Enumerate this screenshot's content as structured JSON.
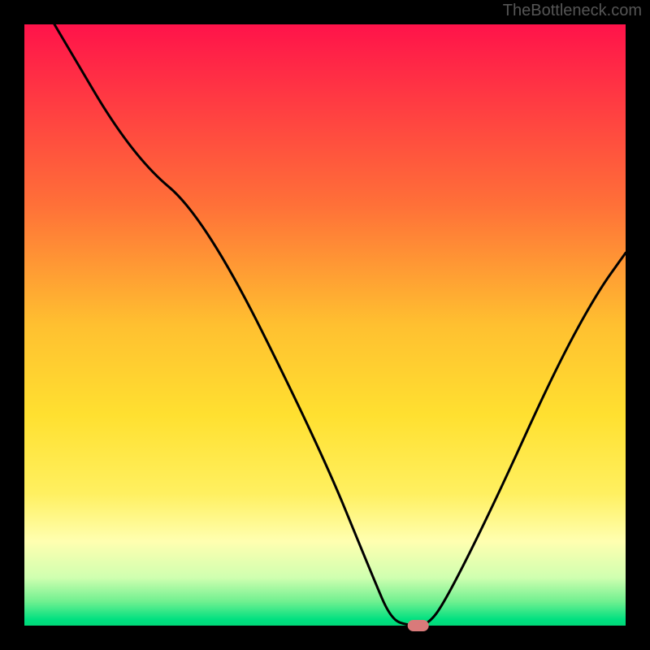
{
  "attribution": "TheBottleneck.com",
  "chart_data": {
    "type": "line",
    "title": "",
    "xlabel": "",
    "ylabel": "",
    "ylim": [
      0,
      100
    ],
    "xlim": [
      0,
      100
    ],
    "background": {
      "type": "vertical_gradient",
      "stops": [
        {
          "offset": 0,
          "color": "#ff134a"
        },
        {
          "offset": 30,
          "color": "#ff7038"
        },
        {
          "offset": 50,
          "color": "#ffc030"
        },
        {
          "offset": 65,
          "color": "#ffe030"
        },
        {
          "offset": 78,
          "color": "#fff060"
        },
        {
          "offset": 86,
          "color": "#ffffb0"
        },
        {
          "offset": 92,
          "color": "#d0ffb0"
        },
        {
          "offset": 96,
          "color": "#70f090"
        },
        {
          "offset": 99,
          "color": "#00e080"
        },
        {
          "offset": 100,
          "color": "#00d878"
        }
      ]
    },
    "series": [
      {
        "name": "bottleneck-curve",
        "color": "#000000",
        "points": [
          {
            "x": 5,
            "y": 100
          },
          {
            "x": 18,
            "y": 78
          },
          {
            "x": 30,
            "y": 68
          },
          {
            "x": 49,
            "y": 30
          },
          {
            "x": 58,
            "y": 8
          },
          {
            "x": 61,
            "y": 1
          },
          {
            "x": 64,
            "y": 0
          },
          {
            "x": 67,
            "y": 0
          },
          {
            "x": 70,
            "y": 4
          },
          {
            "x": 78,
            "y": 20
          },
          {
            "x": 88,
            "y": 42
          },
          {
            "x": 95,
            "y": 55
          },
          {
            "x": 100,
            "y": 62
          }
        ]
      }
    ],
    "marker": {
      "x": 65.5,
      "y": 0,
      "color": "#d97a7a",
      "shape": "rounded-rect"
    },
    "frame": {
      "color": "#000000",
      "width": 30
    }
  }
}
